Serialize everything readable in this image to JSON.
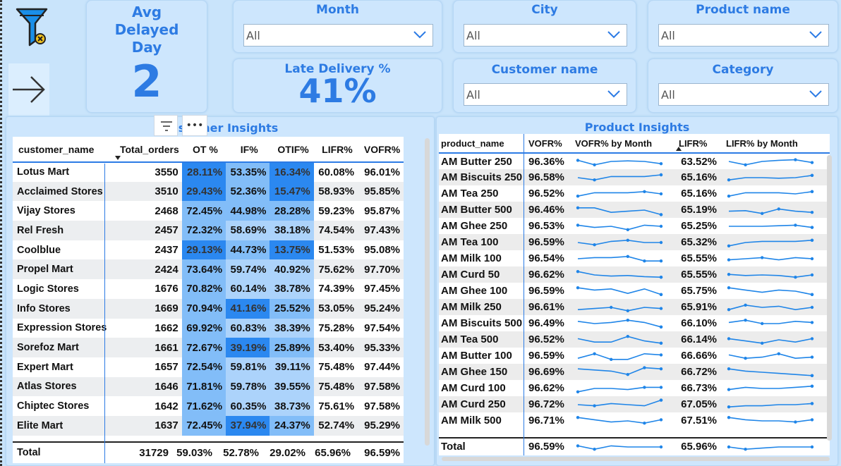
{
  "kpi_avg": {
    "title": "Avg Delayed Day",
    "value": "2"
  },
  "kpi_late": {
    "title": "Late Delivery %",
    "value": "41%"
  },
  "slicers": {
    "month": {
      "label": "Month",
      "value": "All"
    },
    "city": {
      "label": "City",
      "value": "All"
    },
    "product": {
      "label": "Product name",
      "value": "All"
    },
    "customer": {
      "label": "Customer name",
      "value": "All"
    },
    "category": {
      "label": "Category",
      "value": "All"
    }
  },
  "customer_insights": {
    "title": "Customer Insights",
    "headers": [
      "customer_name",
      "Total_orders",
      "OT %",
      "IF%",
      "OTIF%",
      "LIFR%",
      "VOFR%"
    ],
    "rows": [
      [
        "Lotus Mart",
        "3550",
        "28.11%",
        "53.35%",
        "16.34%",
        "60.08%",
        "96.01%"
      ],
      [
        "Acclaimed Stores",
        "3510",
        "29.43%",
        "52.36%",
        "15.47%",
        "58.93%",
        "95.85%"
      ],
      [
        "Vijay Stores",
        "2468",
        "72.45%",
        "44.98%",
        "28.28%",
        "59.23%",
        "95.87%"
      ],
      [
        "Rel Fresh",
        "2457",
        "72.32%",
        "58.69%",
        "38.18%",
        "74.54%",
        "97.43%"
      ],
      [
        "Coolblue",
        "2437",
        "29.13%",
        "44.73%",
        "13.75%",
        "51.53%",
        "95.08%"
      ],
      [
        "Propel Mart",
        "2424",
        "73.64%",
        "59.74%",
        "40.92%",
        "75.62%",
        "97.70%"
      ],
      [
        "Logic Stores",
        "1676",
        "70.82%",
        "60.14%",
        "38.78%",
        "74.39%",
        "97.45%"
      ],
      [
        "Info Stores",
        "1669",
        "70.94%",
        "41.16%",
        "25.52%",
        "53.05%",
        "95.24%"
      ],
      [
        "Expression Stores",
        "1662",
        "69.92%",
        "60.83%",
        "38.39%",
        "75.28%",
        "97.54%"
      ],
      [
        "Sorefoz Mart",
        "1661",
        "72.67%",
        "39.19%",
        "25.89%",
        "53.40%",
        "95.33%"
      ],
      [
        "Expert Mart",
        "1657",
        "72.54%",
        "59.81%",
        "39.11%",
        "75.48%",
        "97.44%"
      ],
      [
        "Atlas Stores",
        "1646",
        "71.81%",
        "59.78%",
        "39.55%",
        "75.48%",
        "97.58%"
      ],
      [
        "Chiptec Stores",
        "1642",
        "71.62%",
        "60.35%",
        "38.73%",
        "75.61%",
        "97.58%"
      ],
      [
        "Elite Mart",
        "1637",
        "72.45%",
        "37.94%",
        "24.37%",
        "52.74%",
        "95.29%"
      ]
    ],
    "total": [
      "Total",
      "31729",
      "59.03%",
      "52.78%",
      "29.02%",
      "65.96%",
      "96.59%"
    ]
  },
  "product_insights": {
    "title": "Product Insights",
    "headers": [
      "product_name",
      "VOFR%",
      "VOFR% by Month",
      "LIFR%",
      "LIFR% by Month"
    ],
    "rows": [
      {
        "name": "AM Butter 250",
        "vofr": "96.36%",
        "lifr": "63.52%",
        "vs": [
          0.6,
          0.2,
          0.5,
          0.55,
          0.5,
          0.3
        ],
        "ls": [
          0.5,
          0.2,
          0.5,
          0.6,
          0.65,
          0.4
        ]
      },
      {
        "name": "AM Biscuits 250",
        "vofr": "96.58%",
        "lifr": "65.16%",
        "vs": [
          0.5,
          0.3,
          0.6,
          0.6,
          0.6,
          0.75
        ],
        "ls": [
          0.3,
          0.5,
          0.5,
          0.45,
          0.5,
          0.7
        ]
      },
      {
        "name": "AM Tea 250",
        "vofr": "96.52%",
        "lifr": "65.16%",
        "vs": [
          0.3,
          0.6,
          0.6,
          0.6,
          0.7,
          0.5
        ],
        "ls": [
          0.3,
          0.6,
          0.6,
          0.6,
          0.5,
          0.7
        ]
      },
      {
        "name": "AM Butter 500",
        "vofr": "96.46%",
        "lifr": "65.19%",
        "vs": [
          0.7,
          0.7,
          0.3,
          0.4,
          0.5,
          0.1
        ],
        "ls": [
          0.4,
          0.45,
          0.2,
          0.6,
          0.4,
          0.3
        ]
      },
      {
        "name": "AM Ghee 250",
        "vofr": "96.53%",
        "lifr": "65.25%",
        "vs": [
          0.6,
          0.4,
          0.5,
          0.2,
          0.6,
          0.5
        ],
        "ls": [
          0.5,
          0.5,
          0.5,
          0.55,
          0.6,
          0.4
        ]
      },
      {
        "name": "AM Tea 100",
        "vofr": "96.59%",
        "lifr": "65.32%",
        "vs": [
          0.5,
          0.3,
          0.6,
          0.7,
          0.5,
          0.5
        ],
        "ls": [
          0.2,
          0.5,
          0.6,
          0.6,
          0.6,
          0.7
        ]
      },
      {
        "name": "AM Milk 100",
        "vofr": "96.54%",
        "lifr": "65.55%",
        "vs": [
          0.5,
          0.6,
          0.6,
          0.7,
          0.3,
          0.3
        ],
        "ls": [
          0.4,
          0.5,
          0.6,
          0.4,
          0.6,
          0.5
        ]
      },
      {
        "name": "AM Curd 50",
        "vofr": "96.62%",
        "lifr": "65.55%",
        "vs": [
          0.8,
          0.5,
          0.4,
          0.45,
          0.35,
          0.3
        ],
        "ls": [
          0.55,
          0.45,
          0.5,
          0.45,
          0.3,
          0.5
        ]
      },
      {
        "name": "AM Ghee 100",
        "vofr": "96.59%",
        "lifr": "65.75%",
        "vs": [
          0.8,
          0.6,
          0.7,
          0.3,
          0.7,
          0.2
        ],
        "ls": [
          0.8,
          0.6,
          0.4,
          0.6,
          0.5,
          0.2
        ]
      },
      {
        "name": "AM Milk 250",
        "vofr": "96.61%",
        "lifr": "65.91%",
        "vs": [
          0.3,
          0.4,
          0.5,
          0.2,
          0.5,
          0.4
        ],
        "ls": [
          0.3,
          0.7,
          0.5,
          0.6,
          0.3,
          0.5
        ]
      },
      {
        "name": "AM Biscuits 500",
        "vofr": "96.49%",
        "lifr": "66.10%",
        "vs": [
          0.7,
          0.5,
          0.6,
          0.8,
          0.6,
          0.2
        ],
        "ls": [
          0.6,
          0.8,
          0.5,
          0.5,
          0.7,
          0.6
        ]
      },
      {
        "name": "AM Tea 500",
        "vofr": "96.52%",
        "lifr": "66.14%",
        "vs": [
          0.6,
          0.3,
          0.3,
          0.8,
          0.4,
          0.2
        ],
        "ls": [
          0.6,
          0.4,
          0.2,
          0.5,
          0.3,
          0.6
        ]
      },
      {
        "name": "AM Butter 100",
        "vofr": "96.59%",
        "lifr": "66.66%",
        "vs": [
          0.3,
          0.7,
          0.2,
          0.2,
          0.7,
          0.6
        ],
        "ls": [
          0.6,
          0.3,
          0.4,
          0.7,
          0.3,
          0.4
        ]
      },
      {
        "name": "AM Ghee 150",
        "vofr": "96.69%",
        "lifr": "66.72%",
        "vs": [
          0.8,
          0.7,
          0.6,
          0.3,
          0.9,
          0.8
        ],
        "ls": [
          0.8,
          0.6,
          0.5,
          0.4,
          0.3,
          0.2
        ]
      },
      {
        "name": "AM Curd 100",
        "vofr": "96.62%",
        "lifr": "66.73%",
        "vs": [
          0.2,
          0.5,
          0.5,
          0.4,
          0.6,
          0.6
        ],
        "ls": [
          0.4,
          0.6,
          0.5,
          0.5,
          0.6,
          0.7
        ]
      },
      {
        "name": "AM Curd 250",
        "vofr": "96.72%",
        "lifr": "67.05%",
        "vs": [
          0.5,
          0.4,
          0.6,
          0.5,
          0.4,
          0.9
        ],
        "ls": [
          0.3,
          0.4,
          0.4,
          0.5,
          0.5,
          0.6
        ]
      },
      {
        "name": "AM Milk 500",
        "vofr": "96.71%",
        "lifr": "67.51%",
        "vs": [
          0.8,
          0.6,
          0.4,
          0.5,
          0.3,
          0.6
        ],
        "ls": [
          0.8,
          0.6,
          0.5,
          0.5,
          0.4,
          0.6
        ]
      }
    ],
    "total": {
      "name": "Total",
      "vofr": "96.59%",
      "lifr": "65.96%",
      "vs": [
        0.6,
        0.3,
        0.6,
        0.5,
        0.5,
        0.5
      ],
      "ls": [
        0.5,
        0.3,
        0.4,
        0.5,
        0.5,
        0.5
      ]
    }
  },
  "colors": {
    "accent": "#2c7be5",
    "ot_dark": "#2b88f0",
    "ot_mid": "#82bdf8",
    "ot_light": "#acd3fb",
    "spark": "#1f85e8"
  },
  "icons": {
    "filter": "filter-clear-icon",
    "nav": "arrow-right-icon"
  }
}
